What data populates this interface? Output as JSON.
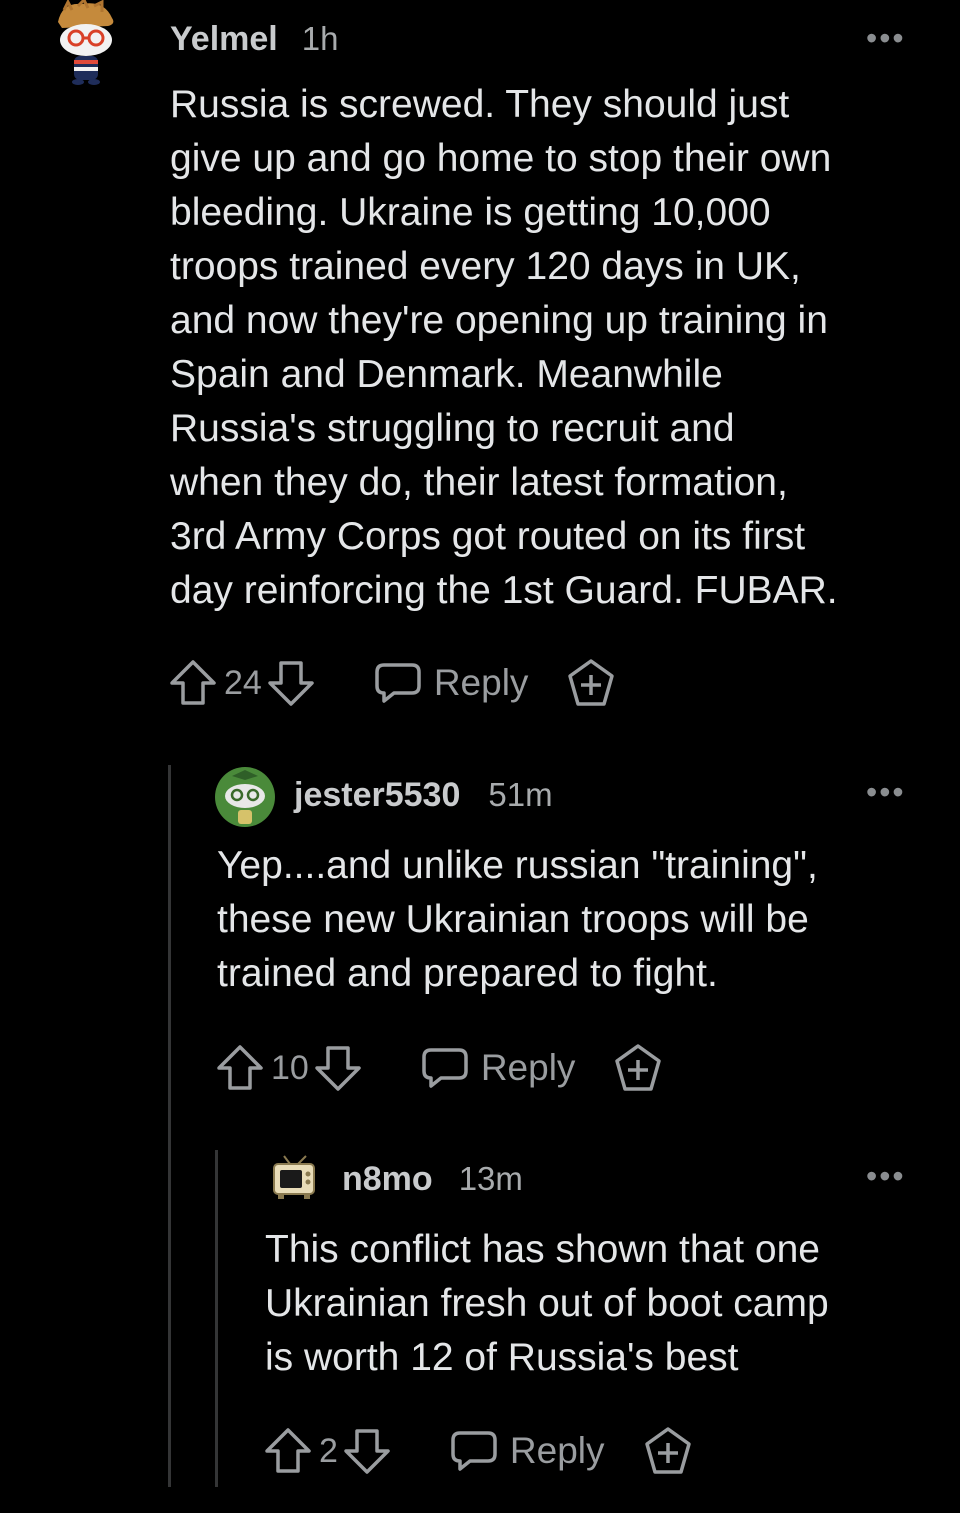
{
  "comments": [
    {
      "username": "Yelmel",
      "time": "1h",
      "text": "Russia is screwed. They should just\ngive up and go home to stop their own\nbleeding. Ukraine is getting 10,000\ntroops trained every 120 days in UK,\nand now they're opening up training in\nSpain and Denmark. Meanwhile\nRussia's struggling to recruit and\nwhen they do, their latest formation,\n3rd Army Corps got routed on its first\nday reinforcing the 1st Guard. FUBAR.",
      "score": "24",
      "reply_label": "Reply",
      "more_label": "•••"
    },
    {
      "username": "jester5530",
      "time": "51m",
      "text": "Yep....and unlike russian \"training\",\nthese new Ukrainian troops will be\ntrained and prepared to fight.",
      "score": "10",
      "reply_label": "Reply",
      "more_label": "•••"
    },
    {
      "username": "n8mo",
      "time": "13m",
      "text": "This conflict has shown that one\nUkrainian fresh out of boot camp\nis worth 12 of Russia's best",
      "score": "2",
      "reply_label": "Reply",
      "more_label": "•••"
    }
  ],
  "icons": {
    "upvote": "arrow-up-icon",
    "downvote": "arrow-down-icon",
    "reply": "chat-bubble-icon",
    "award": "award-plus-icon",
    "more": "more-dots-icon"
  },
  "colors": {
    "background": "#000000",
    "text": "#e4e6e8",
    "muted": "#9a9da0",
    "thread_line": "#343536"
  }
}
